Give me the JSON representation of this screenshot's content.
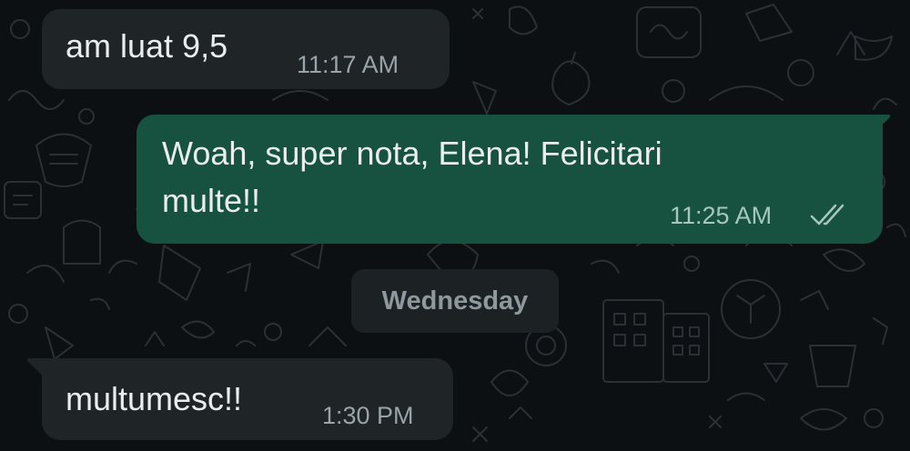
{
  "messages": [
    {
      "direction": "incoming",
      "text": "am luat 9,5",
      "time": "11:17 AM"
    },
    {
      "direction": "outgoing",
      "text_line1": "Woah, super nota, Elena! Felicitari",
      "text_line2": "multe!!",
      "time": "11:25 AM",
      "status": "read-double-check"
    },
    {
      "direction": "incoming",
      "text": "multumesc!!",
      "time": "1:30 PM"
    }
  ],
  "date_separator": "Wednesday",
  "colors": {
    "background": "#0c1012",
    "incoming_bubble": "#1f2426",
    "outgoing_bubble": "#175240",
    "text": "#e9edef",
    "timestamp": "#9aa3a7"
  },
  "icons": [
    "double-check-icon",
    "doodle-wallpaper"
  ]
}
